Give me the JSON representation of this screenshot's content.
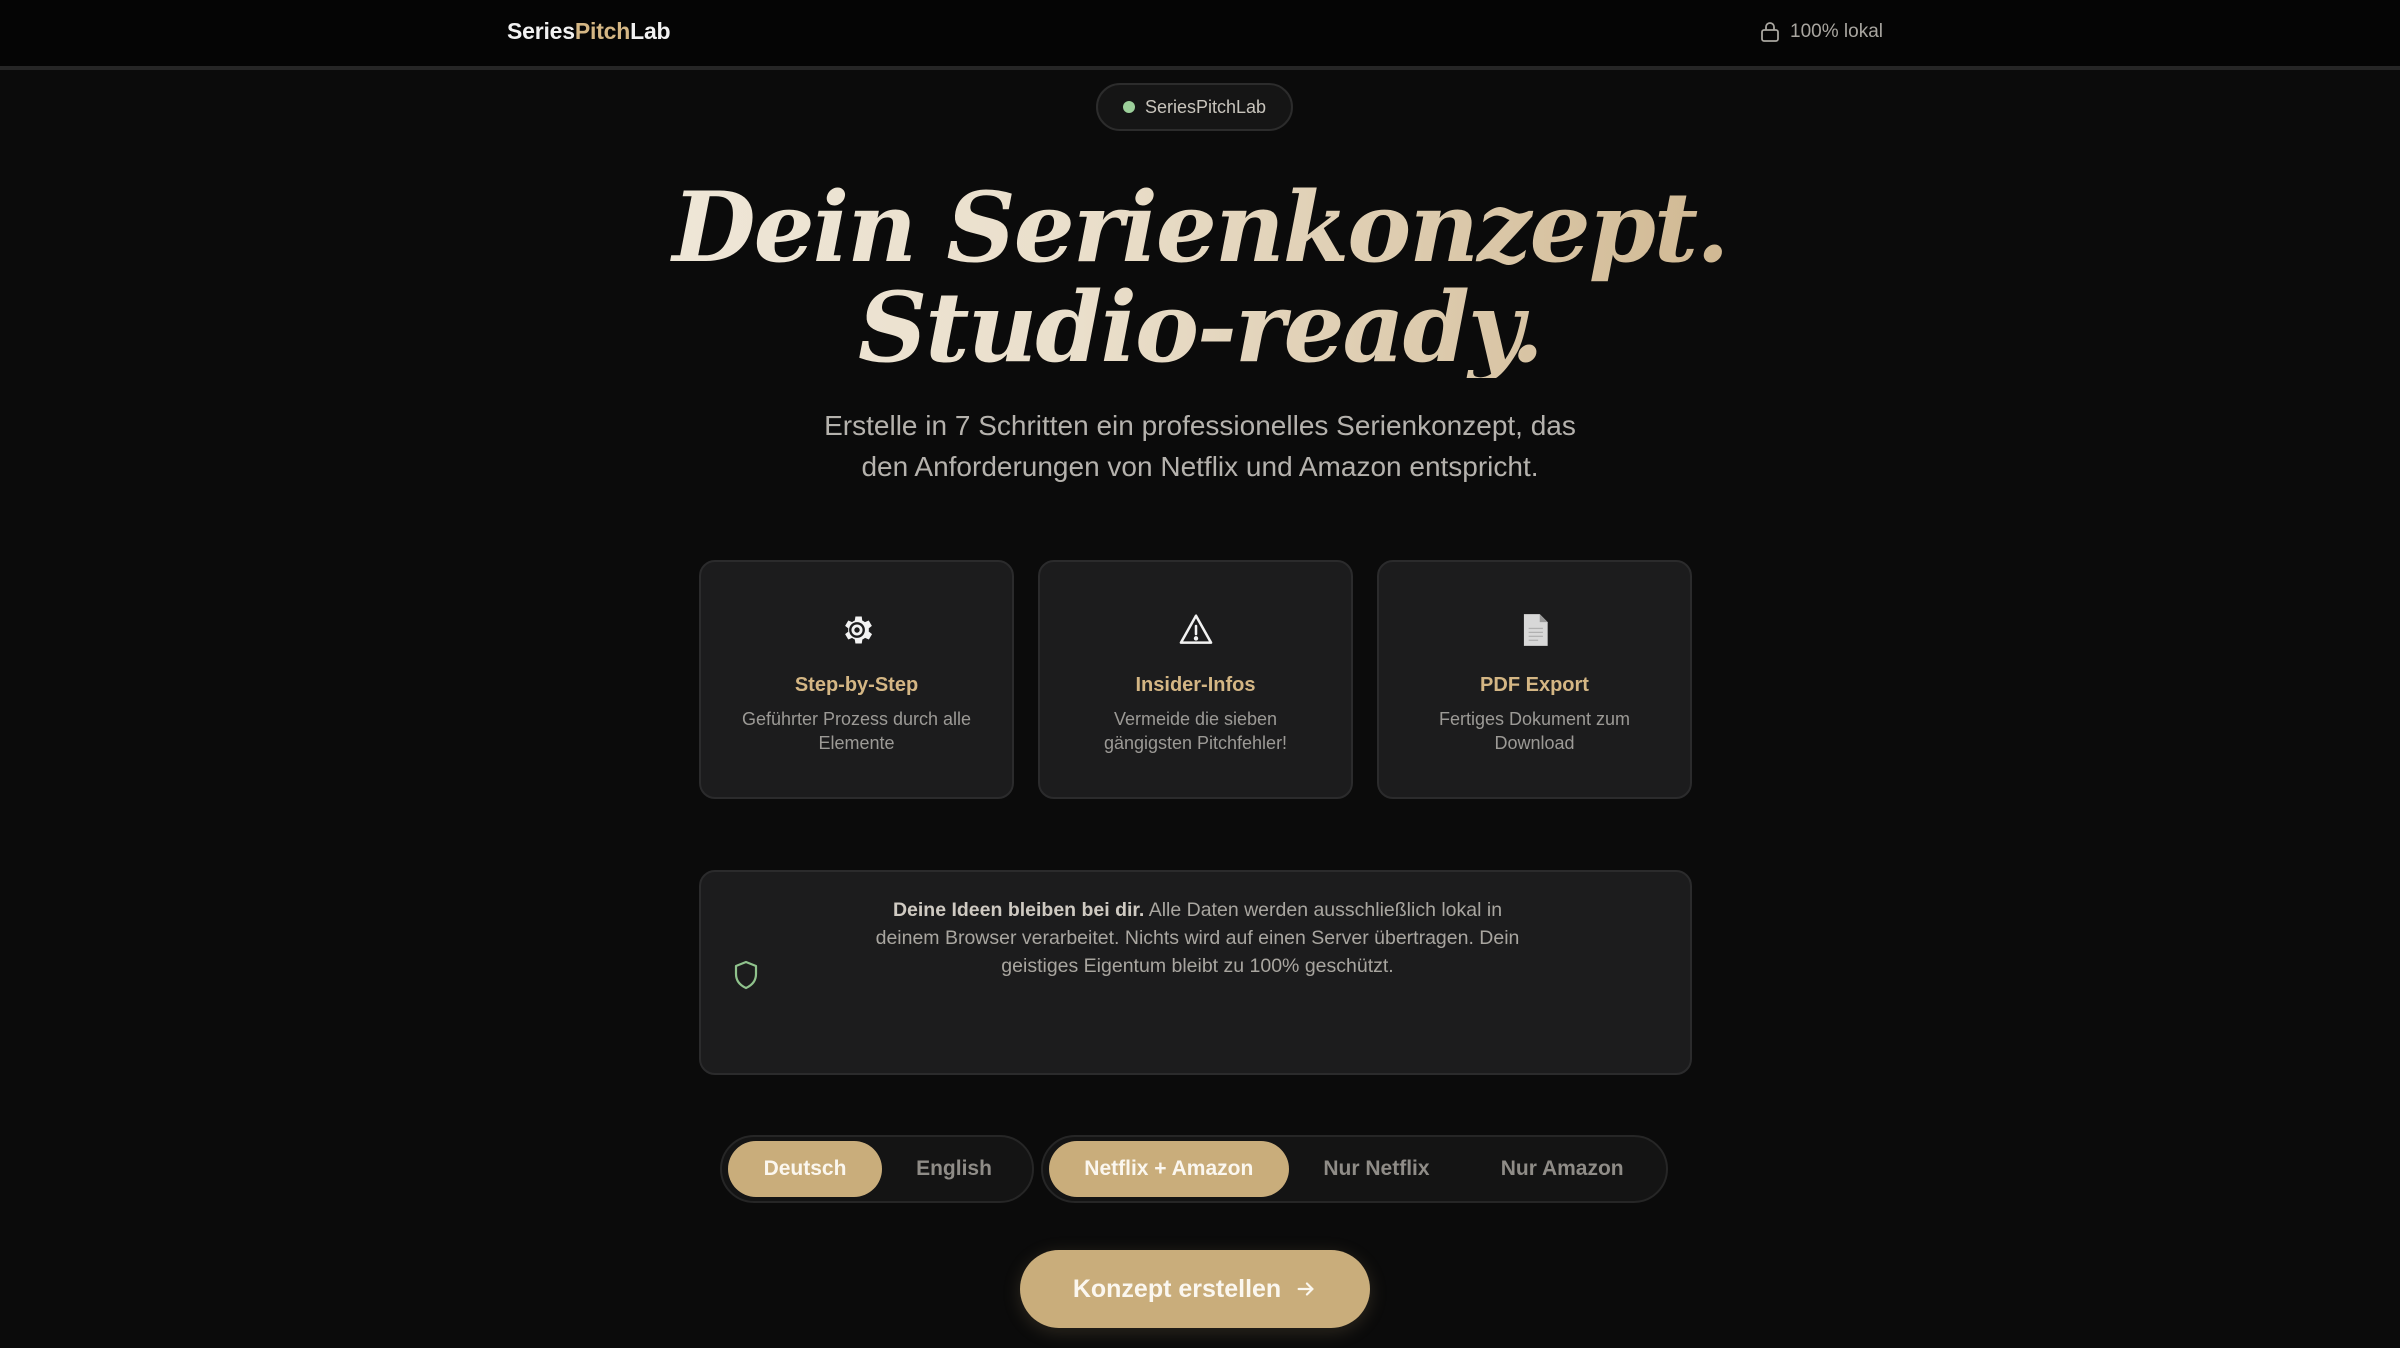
{
  "header": {
    "brand_part1": "Series",
    "brand_part2": "Pitch",
    "brand_part3": "Lab",
    "local_label": "100% lokal"
  },
  "pill": {
    "label": "SeriesPitchLab"
  },
  "hero": {
    "title_line1": "Dein Serienkonzept.",
    "title_line2": "Studio-ready.",
    "subtitle_line1": "Erstelle in 7 Schritten ein professionelles Serienkonzept, das",
    "subtitle_line2": "den Anforderungen von Netflix und Amazon entspricht."
  },
  "features": [
    {
      "icon": "gear-icon",
      "title": "Step-by-Step",
      "desc": "Geführter Prozess durch alle Elemente"
    },
    {
      "icon": "warning-icon",
      "title": "Insider-Infos",
      "desc": "Vermeide die sieben gängigsten Pitchfehler!"
    },
    {
      "icon": "document-icon",
      "title": "PDF Export",
      "desc": "Fertiges Dokument zum Download"
    }
  ],
  "privacy": {
    "bold": "Deine Ideen bleiben bei dir.",
    "text": " Alle Daten werden ausschließlich lokal in deinem Browser verarbeitet. Nichts wird auf einen Server übertragen. Dein geistiges Eigentum bleibt zu 100% geschützt."
  },
  "language": {
    "options": [
      "Deutsch",
      "English"
    ],
    "selected": "Deutsch"
  },
  "platform": {
    "options": [
      "Netflix + Amazon",
      "Nur Netflix",
      "Nur Amazon"
    ],
    "selected": "Netflix + Amazon"
  },
  "cta": {
    "label": "Konzept erstellen"
  },
  "colors": {
    "background": "#0b0b0b",
    "accent": "#c9ad7b",
    "accent_text": "#d4b684",
    "status_dot": "#9ccf9a"
  }
}
